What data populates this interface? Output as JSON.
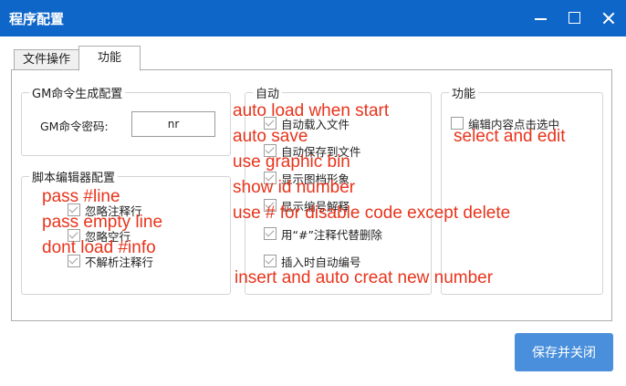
{
  "window": {
    "title": "程序配置"
  },
  "tabs": [
    {
      "label": "文件操作"
    },
    {
      "label": "功能"
    }
  ],
  "gm_group": {
    "title": "GM命令生成配置",
    "password_label": "GM命令密码:",
    "password_value": "nr"
  },
  "editor_group": {
    "title": "脚本编辑器配置",
    "items": [
      {
        "label": "忽略注释行",
        "checked": true
      },
      {
        "label": "忽略空行",
        "checked": true
      },
      {
        "label": "不解析注释行",
        "checked": true
      }
    ]
  },
  "auto_group": {
    "title": "自动",
    "items": [
      {
        "label": "自动载入文件",
        "checked": true
      },
      {
        "label": "自动保存到文件",
        "checked": true
      },
      {
        "label": "显示图档形象",
        "checked": true
      },
      {
        "label": "显示编号解释",
        "checked": true
      },
      {
        "label": "用“#”注释代替删除",
        "checked": true
      },
      {
        "label": "插入时自动编号",
        "checked": true
      }
    ]
  },
  "func_group": {
    "title": "功能",
    "items": [
      {
        "label": "编辑内容点击选中",
        "checked": false
      }
    ]
  },
  "annotations": {
    "auto_load": "auto load when start",
    "auto_save": "auto save",
    "graphic_bin": "use graphic bin",
    "show_id": "show id number",
    "use_hash": "use # for disable code except delete",
    "insert_auto": "insert and auto creat new number",
    "select_edit": "select and edit",
    "pass_line": "pass #line",
    "pass_empty": "pass empty line",
    "dont_load": "dont load #info"
  },
  "save_button": {
    "label": "保存并关闭"
  },
  "colors": {
    "titlebar": "#0f66c9",
    "annotation": "#e8341c",
    "button": "#4a8fdc"
  }
}
